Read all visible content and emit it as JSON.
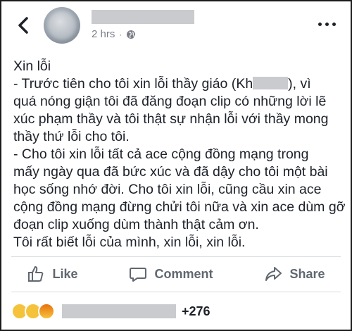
{
  "header": {
    "timestamp": "2 hrs",
    "separator": "·",
    "icons": {
      "back": "chevron-left-icon",
      "privacy": "globe-icon",
      "more": "more-dots-icon"
    }
  },
  "post": {
    "lines": [
      "Xin lỗi",
      "    - Trước tiên cho tôi xin lỗi thầy giáo (",
      "quá nóng giận tôi đã đăng đoạn clip có những lời lẽ",
      "xúc phạm thầy và tôi thật sự nhận lỗi với thầy mong",
      "thầy thứ lỗi cho tôi.",
      "    - Cho tôi xin lỗi tất cả ace cộng đồng mạng trong",
      "mấy ngày qua đã bức xúc và đã dậy cho tôi một bài",
      "học sống nhớ đời. Cho tôi xin lỗi, cũng cầu xin ace",
      "cộng đồng mạng đừng chửi tôi nữa và xin ace dùm gỡ",
      "đoạn clip xuống dùm thành thật cảm ơn.",
      "  Tôi rất biết lỗi của mình, xin lỗi, xin lỗi."
    ],
    "teacher_name_partial": "Kh",
    "teacher_name_suffix": "), vì"
  },
  "actions": {
    "like_label": "Like",
    "comment_label": "Comment",
    "share_label": "Share"
  },
  "reactions": {
    "count": "+276",
    "types": [
      "haha",
      "wow",
      "angry"
    ]
  },
  "colors": {
    "text": "#1d2129",
    "muted": "#606770",
    "redaction": "#c9cbce",
    "divider": "#dadde1"
  }
}
